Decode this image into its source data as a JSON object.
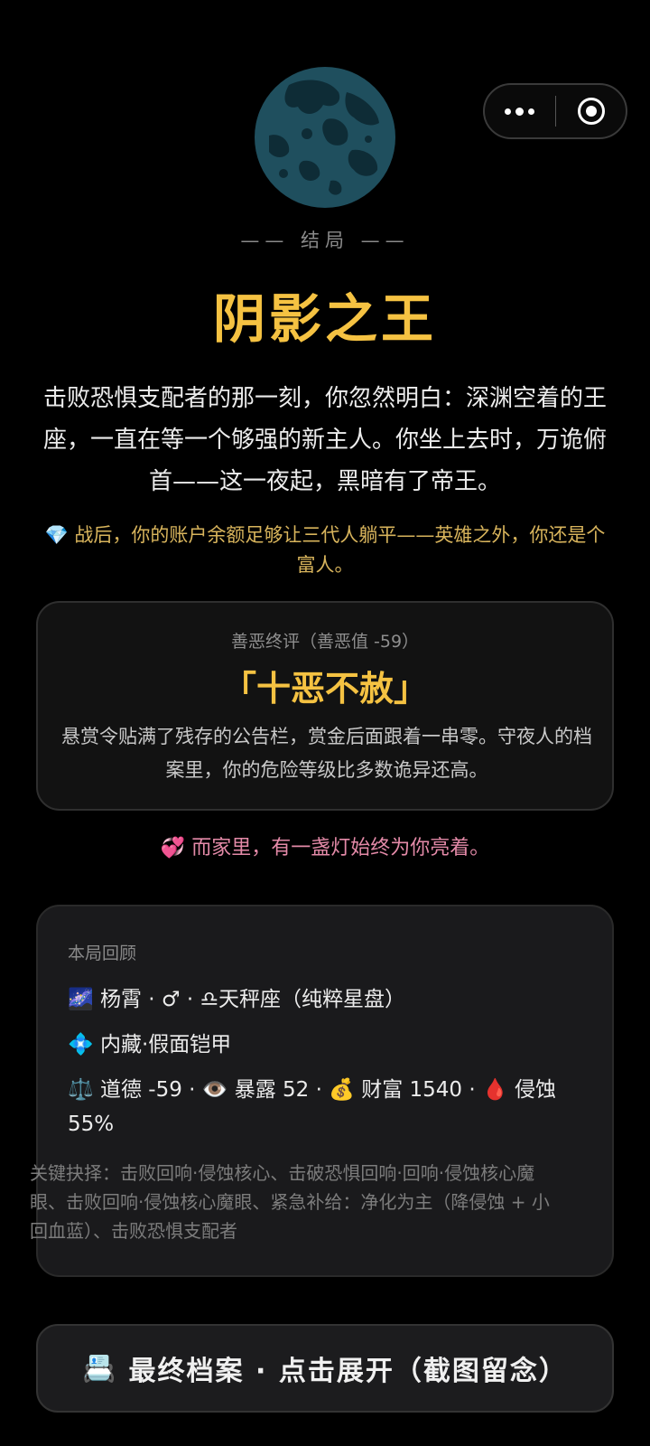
{
  "colors": {
    "accent_gold": "#f5c242",
    "wealth_text": "#d8b45c",
    "home_text": "#e48aa8",
    "moon": "#1f4f5e"
  },
  "capsule": {
    "more_icon": "more-dots-icon",
    "close_icon": "target-close-icon"
  },
  "ending": {
    "label": "—— 结局 ——",
    "title": "阴影之王",
    "description": "击败恐惧支配者的那一刻，你忽然明白：深渊空着的王座，一直在等一个够强的新主人。你坐上去时，万诡俯首——这一夜起，黑暗有了帝王。",
    "wealth_icon": "💎",
    "wealth_note": "战后，你的账户余额足够让三代人躺平——英雄之外，你还是个富人。"
  },
  "verdict": {
    "heading": "善恶终评（善恶值 -59）",
    "title": "「十恶不赦」",
    "text": "悬赏令贴满了残存的公告栏，赏金后面跟着一串零。守夜人的档案里，你的危险等级比多数诡异还高。"
  },
  "home": {
    "icon": "💞",
    "text": "而家里，有一盏灯始终为你亮着。"
  },
  "review": {
    "heading": "本局回顾",
    "identity": {
      "icon": "🌌",
      "text": "杨霄 · ♂ · ♎天秤座（纯粹星盘）"
    },
    "talent": {
      "icon": "💠",
      "text": "内藏·假面铠甲"
    },
    "stats": {
      "morality_icon": "⚖️",
      "morality": "道德 -59",
      "exposure_icon": "👁️",
      "exposure": "暴露 52",
      "wealth_icon": "💰",
      "wealth": "财富 1540",
      "corrosion_icon": "🩸",
      "corrosion": "侵蚀 55%",
      "separator": " · "
    },
    "choices": "关键抉择：击败回响·侵蚀核心、击破恐惧回响·回响·侵蚀核心魔眼、击败回响·侵蚀核心魔眼、紧急补给：净化为主（降侵蚀 + 小回血蓝）、击败恐惧支配者"
  },
  "archive_button": {
    "icon": "📇",
    "label": "最终档案 · 点击展开（截图留念）"
  }
}
